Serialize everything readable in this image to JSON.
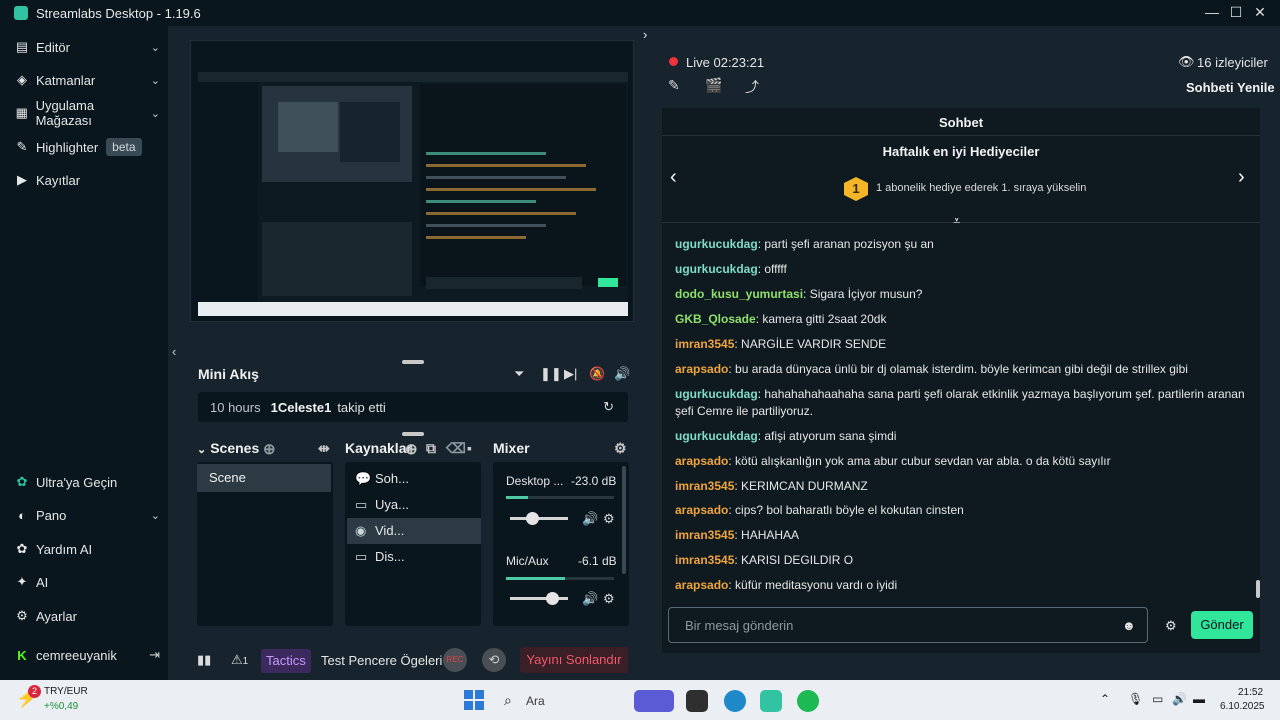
{
  "window": {
    "title": "Streamlabs Desktop - 1.19.6"
  },
  "sidebar": {
    "items": [
      {
        "label": "Editör",
        "icon": "editor-icon"
      },
      {
        "label": "Katmanlar",
        "icon": "layers-icon"
      },
      {
        "label": "Uygulama Mağazası",
        "icon": "store-icon"
      },
      {
        "label": "Highlighter",
        "icon": "highlighter-icon",
        "badge": "beta"
      },
      {
        "label": "Kayıtlar",
        "icon": "recordings-icon"
      }
    ],
    "bottom_items": [
      {
        "label": "Ultra'ya Geçin",
        "icon": "ultra-icon"
      },
      {
        "label": "Pano",
        "icon": "dashboard-icon"
      },
      {
        "label": "Yardım AI",
        "icon": "help-ai-icon"
      },
      {
        "label": "AI",
        "icon": "ai-icon"
      },
      {
        "label": "Ayarlar",
        "icon": "settings-icon"
      },
      {
        "label": "cemreeuyanik",
        "icon": "kick-icon"
      }
    ]
  },
  "mini_feed": {
    "title": "Mini Akış",
    "time": "10 hours",
    "user": "1Celeste1",
    "action": "takip etti"
  },
  "scenes": {
    "title": "Scenes",
    "items": [
      "Scene"
    ]
  },
  "sources": {
    "title": "Kaynaklar",
    "items": [
      {
        "label": "Soh...",
        "icon": "chat-source-icon"
      },
      {
        "label": "Uya...",
        "icon": "alert-source-icon"
      },
      {
        "label": "Vid...",
        "icon": "webcam-source-icon"
      },
      {
        "label": "Dis...",
        "icon": "display-source-icon"
      }
    ]
  },
  "mixer": {
    "title": "Mixer",
    "channels": [
      {
        "name": "Desktop ...",
        "db": "-23.0 dB",
        "level": 0.2
      },
      {
        "name": "Mic/Aux",
        "db": "-6.1 dB",
        "level": 0.55
      }
    ]
  },
  "bottom_bar": {
    "alert_count": "1",
    "tactics": "Tactics",
    "test_items": "Test Pencere Ögeleri",
    "rec": "REC",
    "end_stream": "Yayını Sonlandır"
  },
  "stream": {
    "live_label": "Live",
    "duration": "02:23:21",
    "viewers": "16 izleyiciler",
    "refresh_chat": "Sohbeti Yenile"
  },
  "chat": {
    "title": "Sohbet",
    "gifters_title": "Haftalık en iyi Hediyeciler",
    "gift_rank": "1",
    "gift_text": "1 abonelik hediye ederek 1. sıraya yükselin",
    "input_placeholder": "Bir mesaj gönderin",
    "send_label": "Gönder",
    "messages": [
      {
        "user": "ugurkucukdag",
        "color": "#7fdcc7",
        "text": "parti şefi aranan pozisyon şu an"
      },
      {
        "user": "ugurkucukdag",
        "color": "#7fdcc7",
        "text": "offfff"
      },
      {
        "user": "dodo_kusu_yumurtasi",
        "color": "#8fe06a",
        "text": "Sigara İçiyor musun?"
      },
      {
        "user": "GKB_Qlosade",
        "color": "#8fe06a",
        "text": "kamera gitti 2saat 20dk"
      },
      {
        "user": "imran3545",
        "color": "#f0a43c",
        "text": "NARGİLE VARDIR SENDE"
      },
      {
        "user": "arapsado",
        "color": "#f0a43c",
        "text": "bu arada dünyaca ünlü bir dj olamak isterdim. böyle kerimcan gibi değil de strillex gibi"
      },
      {
        "user": "ugurkucukdag",
        "color": "#7fdcc7",
        "text": "hahahahahaahaha sana parti şefi olarak etkinlik yazmaya başlıyorum şef. partilerin aranan şefi Cemre ile partiliyoruz."
      },
      {
        "user": "ugurkucukdag",
        "color": "#7fdcc7",
        "text": "afişi atıyorum sana şimdi"
      },
      {
        "user": "arapsado",
        "color": "#f0a43c",
        "text": "kötü alışkanlığın yok ama abur cubur sevdan var abla. o da kötü sayılır"
      },
      {
        "user": "imran3545",
        "color": "#f0a43c",
        "text": "KERIMCAN DURMANZ"
      },
      {
        "user": "arapsado",
        "color": "#f0a43c",
        "text": "cips? bol baharatlı böyle el kokutan cinsten"
      },
      {
        "user": "imran3545",
        "color": "#f0a43c",
        "text": "HAHAHAA"
      },
      {
        "user": "imran3545",
        "color": "#f0a43c",
        "text": "KARISI DEGILDIR O"
      },
      {
        "user": "arapsado",
        "color": "#f0a43c",
        "text": "küfür meditasyonu vardı o iyidi"
      }
    ]
  },
  "taskbar": {
    "currency": "TRY/EUR",
    "change": "+%0,49",
    "notif_count": "2",
    "search": "Ara",
    "time": "21:52",
    "date": "6.10.2025"
  },
  "colors": {
    "accent": "#31e59b",
    "brand": "#31c3a2",
    "live": "#f0323b",
    "end_stream": "#f05a6b"
  }
}
